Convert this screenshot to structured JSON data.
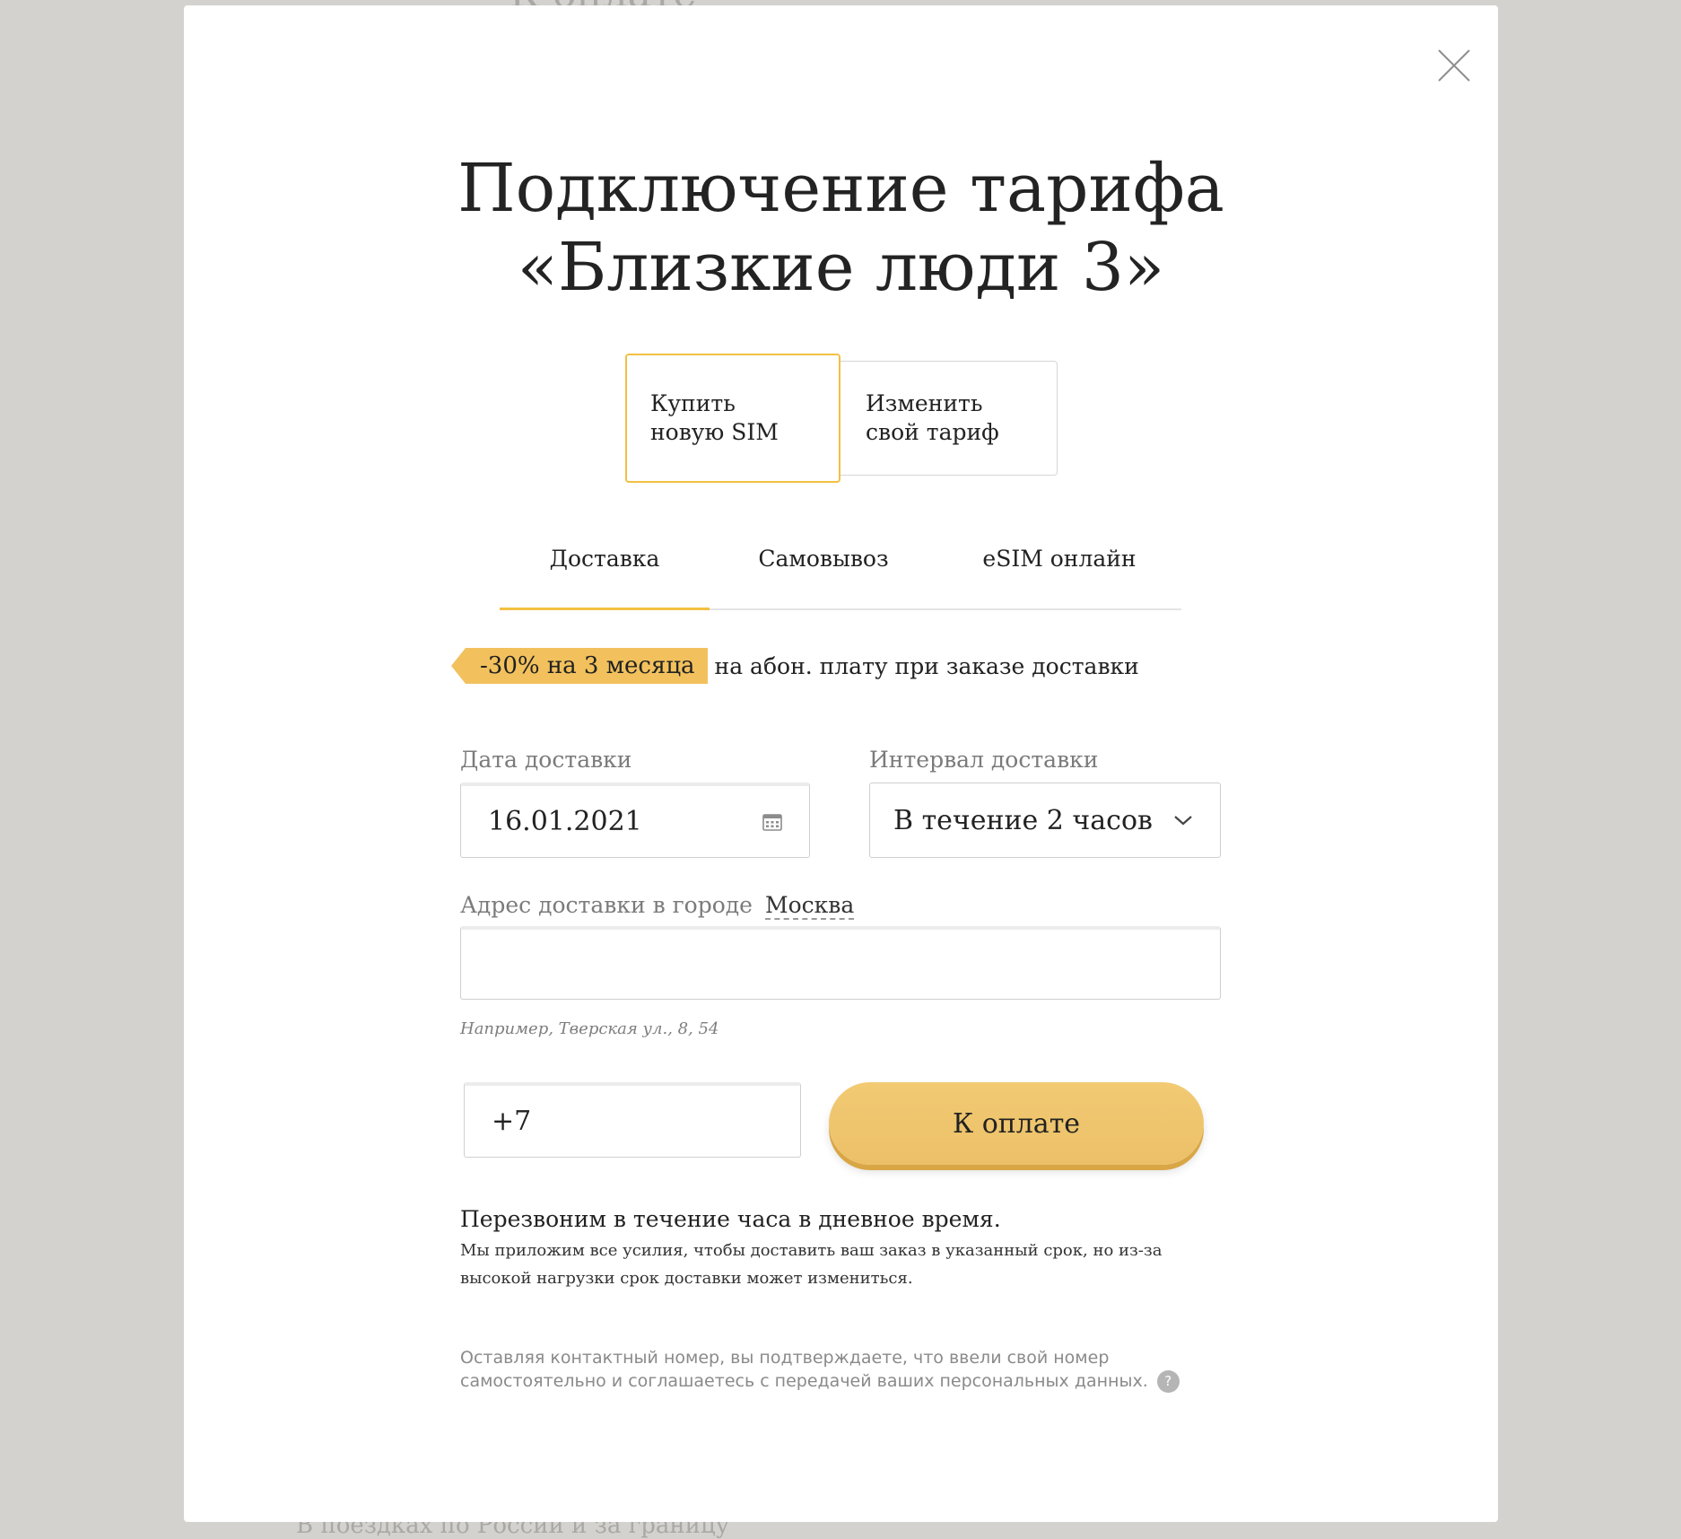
{
  "background": {
    "title_fragment": "К оплате",
    "bottom_fragment": "В поездках по России и за границу"
  },
  "modal": {
    "title_line1": "Подключение тарифа",
    "title_line2": "«Близкие люди 3»",
    "close_icon": "close-icon",
    "choices": [
      {
        "label": "Купить новую SIM",
        "selected": true
      },
      {
        "label": "Изменить свой тариф",
        "selected": false
      }
    ],
    "tabs": [
      {
        "label": "Доставка",
        "active": true
      },
      {
        "label": "Самовывоз",
        "active": false
      },
      {
        "label": "eSIM онлайн",
        "active": false
      }
    ],
    "promo": {
      "badge": "-30% на 3 месяца",
      "text": "на абон. плату при заказе доставки"
    },
    "form": {
      "date_label": "Дата доставки",
      "date_value": "16.01.2021",
      "date_icon": "calendar-icon",
      "interval_label": "Интервал доставки",
      "interval_value": "В течение 2 часов",
      "interval_icon": "chevron-down-icon",
      "address_label": "Адрес доставки в городе",
      "city": "Москва",
      "address_value": "",
      "address_hint": "Например, Тверская ул., 8, 54",
      "phone_value": "+7",
      "submit_label": "К оплате"
    },
    "callback_title": "Перезвоним в течение часа в дневное время.",
    "callback_note": "Мы приложим все усилия, чтобы доставить ваш заказ в указанный срок, но из-за высокой нагрузки срок доставки может измениться.",
    "consent_text": "Оставляя контактный номер, вы подтверждаете, что ввели свой номер самостоятельно и соглашаетесь с передачей ваших персональных данных.",
    "help_icon": "question-icon",
    "help_glyph": "?"
  },
  "colors": {
    "accent": "#f3c042",
    "button": "#efc56f",
    "backdrop": "#d3d2ce"
  }
}
